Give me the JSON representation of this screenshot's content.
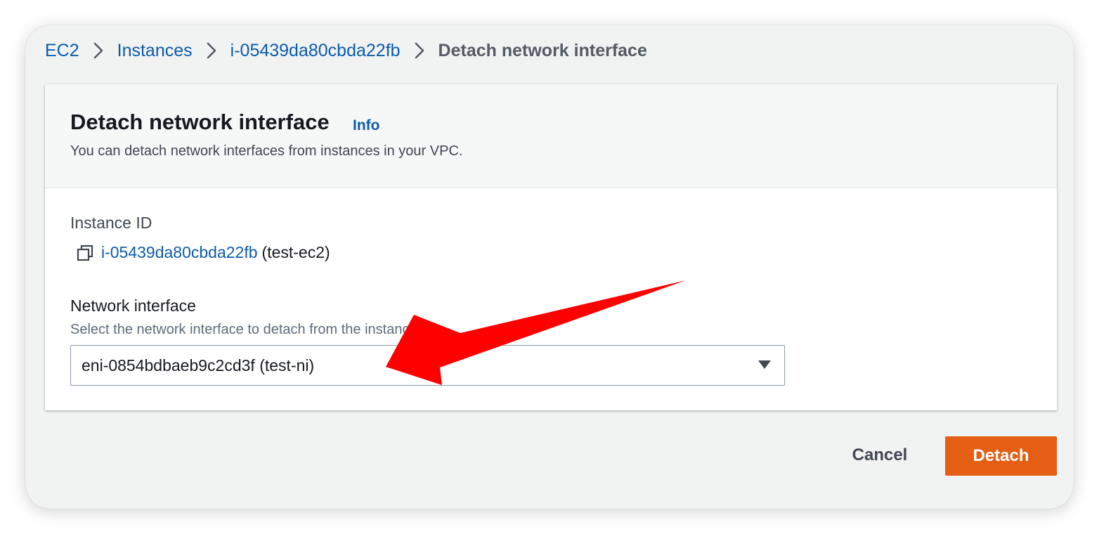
{
  "breadcrumb": {
    "items": [
      "EC2",
      "Instances",
      "i-05439da80cbda22fb"
    ],
    "current": "Detach network interface"
  },
  "panel": {
    "title": "Detach network interface",
    "info_link": "Info",
    "description": "You can detach network interfaces from instances in your VPC."
  },
  "instance": {
    "label": "Instance ID",
    "id": "i-05439da80cbda22fb",
    "name_suffix": "(test-ec2)"
  },
  "network_interface": {
    "label": "Network interface",
    "hint": "Select the network interface to detach from the instance",
    "selected": "eni-0854bdbaeb9c2cd3f (test-ni)"
  },
  "actions": {
    "cancel_label": "Cancel",
    "detach_label": "Detach"
  },
  "colors": {
    "link": "#0b5cab",
    "primary_button": "#e45e14",
    "annotation_arrow": "#ff0000"
  },
  "icons": [
    "chevron-right-icon",
    "copy-icon",
    "caret-down-icon",
    "red-arrow-annotation"
  ]
}
